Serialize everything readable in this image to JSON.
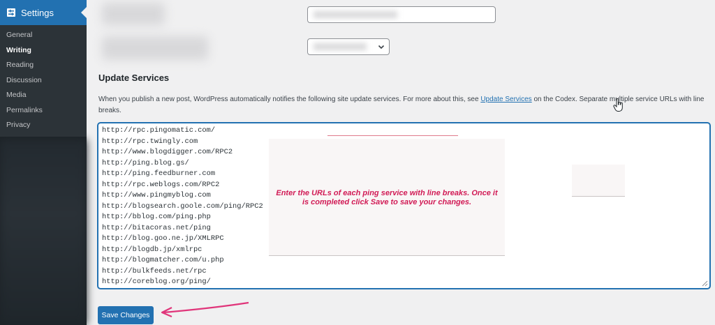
{
  "sidebar": {
    "section_title": "Settings",
    "items": [
      {
        "label": "General",
        "current": false
      },
      {
        "label": "Writing",
        "current": true
      },
      {
        "label": "Reading",
        "current": false
      },
      {
        "label": "Discussion",
        "current": false
      },
      {
        "label": "Media",
        "current": false
      },
      {
        "label": "Permalinks",
        "current": false
      },
      {
        "label": "Privacy",
        "current": false
      }
    ],
    "icon": "settings-sliders-icon"
  },
  "update_services": {
    "title": "Update Services",
    "description_before": "When you publish a new post, WordPress automatically notifies the following site update services. For more about this, see ",
    "link_text": "Update Services",
    "description_after": " on the Codex. Separate multiple service URLs with line breaks.",
    "urls": [
      "http://rpc.pingomatic.com/",
      "http://rpc.twingly.com",
      "http://www.blogdigger.com/RPC2",
      "http://ping.blog.gs/",
      "http://ping.feedburner.com",
      "http://rpc.weblogs.com/RPC2",
      "http://www.pingmyblog.com",
      "http://blogsearch.goole.com/ping/RPC2",
      "http://bblog.com/ping.php",
      "http://bitacoras.net/ping",
      "http://blog.goo.ne.jp/XMLRPC",
      "http://blogdb.jp/xmlrpc",
      "http://blogmatcher.com/u.php",
      "http://bulkfeeds.net/rpc",
      "http://coreblog.org/ping/"
    ]
  },
  "annotation": {
    "note": "Enter the URLs of each ping service with line breaks. Once it is completed click Save to save your changes.",
    "note_color": "#d11a55",
    "arrow_color": "#e0357a"
  },
  "save_button": {
    "label": "Save Changes"
  },
  "colors": {
    "accent": "#2271b1",
    "sidebar_bg": "#1d2327",
    "submenu_bg": "#2c3338",
    "page_bg": "#f0f0f1"
  }
}
